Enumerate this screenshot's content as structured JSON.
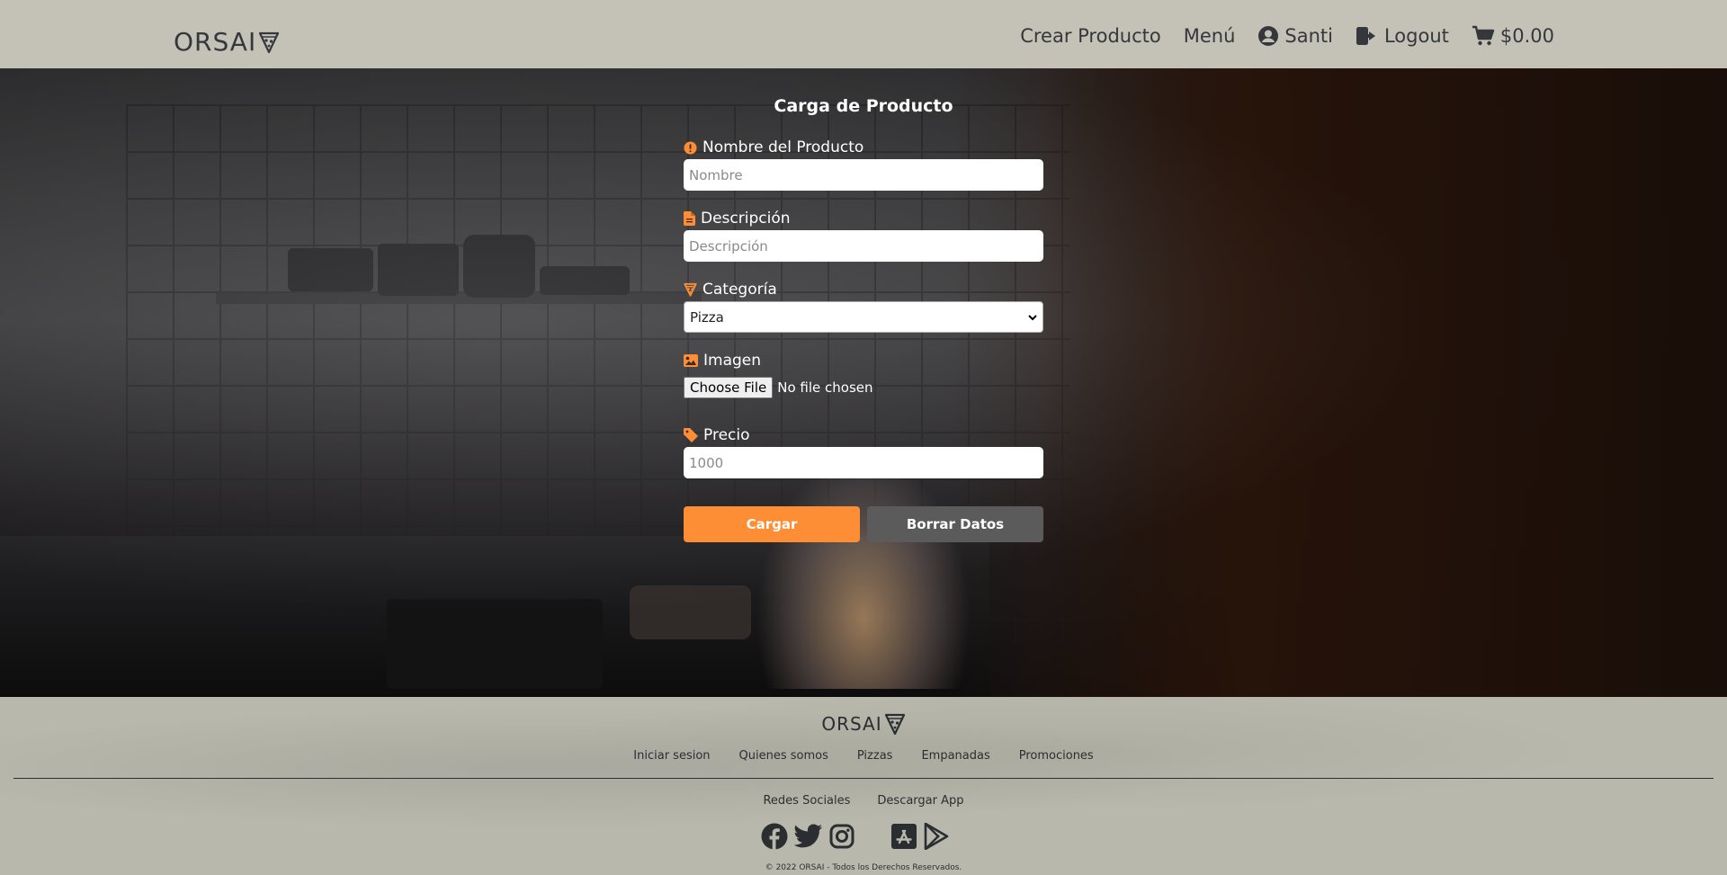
{
  "header": {
    "brand": "ORSAI",
    "nav": {
      "crear_producto": "Crear Producto",
      "menu": "Menú",
      "user": "Santi",
      "logout": "Logout",
      "cart_total": "$0.00"
    }
  },
  "form": {
    "title": "Carga de Producto",
    "nombre": {
      "label": "Nombre del Producto",
      "placeholder": "Nombre",
      "value": ""
    },
    "descripcion": {
      "label": "Descripción",
      "placeholder": "Descripción",
      "value": ""
    },
    "categoria": {
      "label": "Categoría",
      "selected": "Pizza",
      "options": [
        "Pizza"
      ]
    },
    "imagen": {
      "label": "Imagen",
      "button": "Choose File",
      "status": "No file chosen"
    },
    "precio": {
      "label": "Precio",
      "placeholder": "1000",
      "value": ""
    },
    "submit_label": "Cargar",
    "reset_label": "Borrar Datos"
  },
  "footer": {
    "brand": "ORSAI",
    "links": [
      "Iniciar sesion",
      "Quienes somos",
      "Pizzas",
      "Empanadas",
      "Promociones"
    ],
    "social_heading": "Redes Sociales",
    "app_heading": "Descargar App",
    "social_icons": [
      "facebook-icon",
      "twitter-icon",
      "instagram-icon"
    ],
    "app_icons": [
      "app-store-icon",
      "google-play-icon"
    ],
    "copyright": "© 2022 ORSAI - Todos los Derechos Reservados."
  },
  "colors": {
    "header_bg": "#c4c1b6",
    "accent": "#fd8e36",
    "secondary_button": "#5b5b5b",
    "footer_bg": "#b9b8ac",
    "text_dark": "#34383d"
  }
}
